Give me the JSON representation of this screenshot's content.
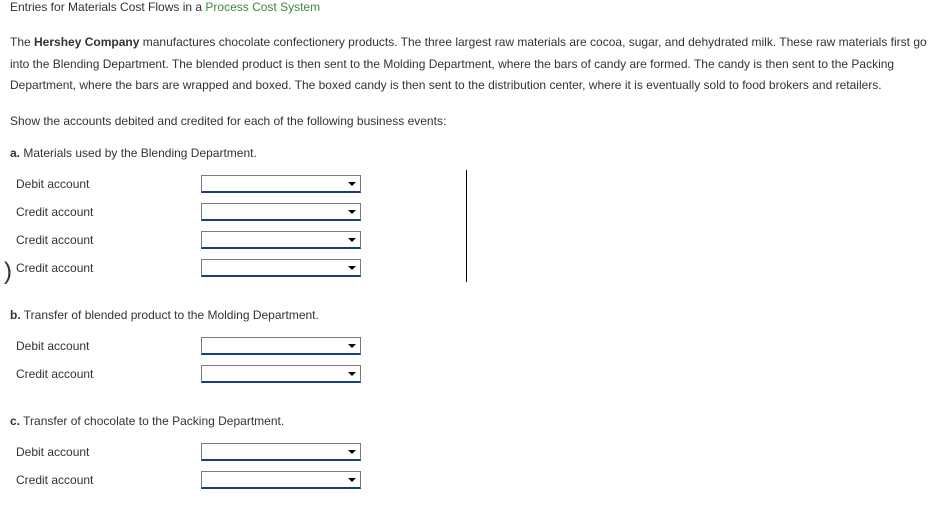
{
  "title": {
    "prefix": "Entries for Materials Cost Flows in a ",
    "link": "Process Cost System"
  },
  "paragraph": {
    "seg1": "The ",
    "bold": "Hershey Company",
    "seg2": " manufactures chocolate confectionery products. The three largest raw materials are cocoa, sugar, and dehydrated milk. These raw materials first go into the Blending Department. The blended product is then sent to the Molding Department, where the bars of candy are formed. The candy is then sent to the Packing Department, where the bars are wrapped and boxed. The boxed candy is then sent to the distribution center, where it is eventually sold to food brokers and retailers."
  },
  "instruction": "Show the accounts debited and credited for each of the following business events:",
  "sections": {
    "a": {
      "letter": "a.",
      "text": "Materials used by the Blending Department.",
      "rows": [
        {
          "label": "Debit account"
        },
        {
          "label": "Credit account"
        },
        {
          "label": "Credit account"
        },
        {
          "label": "Credit account"
        }
      ]
    },
    "b": {
      "letter": "b.",
      "text": "Transfer of blended product to the Molding Department.",
      "rows": [
        {
          "label": "Debit account"
        },
        {
          "label": "Credit account"
        }
      ]
    },
    "c": {
      "letter": "c.",
      "text": "Transfer of chocolate to the Packing Department.",
      "rows": [
        {
          "label": "Debit account"
        },
        {
          "label": "Credit account"
        }
      ]
    }
  }
}
